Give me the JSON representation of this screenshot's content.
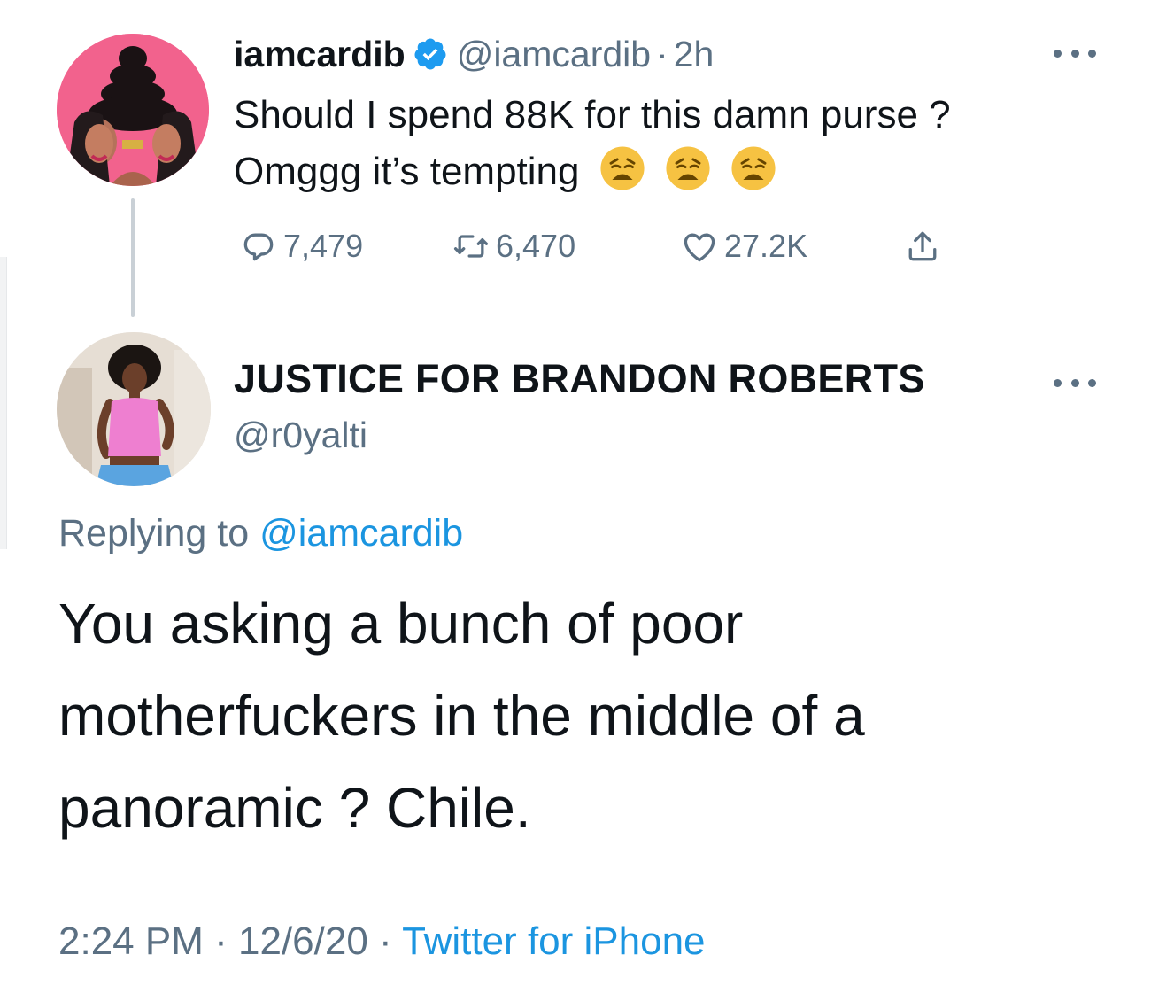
{
  "parent_tweet": {
    "display_name": "iamcardib",
    "handle": "@iamcardib",
    "separator": "·",
    "time": "2h",
    "text_line1": "Should I spend 88K for this damn purse ?",
    "text_line2": "Omggg it’s tempting",
    "emoji": [
      "weary-face-icon",
      "weary-face-icon",
      "weary-face-icon"
    ],
    "stats": {
      "replies": "7,479",
      "retweets": "6,470",
      "likes": "27.2K"
    }
  },
  "reply_tweet": {
    "display_name": "JUSTICE FOR BRANDON ROBERTS",
    "handle": "@r0yalti",
    "replying_prefix": "Replying to",
    "replying_to": "@iamcardib",
    "text_lines": [
      "You asking a bunch of poor",
      "motherfuckers in the middle of a",
      "panoramic ? Chile."
    ],
    "time": "2:24 PM",
    "date": "12/6/20",
    "source": "Twitter for iPhone",
    "separator": "·"
  },
  "colors": {
    "text": "#0f1419",
    "secondary": "#5b7083",
    "link": "#1b95e0",
    "verified": "#1d9bf0",
    "avatar_pink": "#f2628d"
  }
}
